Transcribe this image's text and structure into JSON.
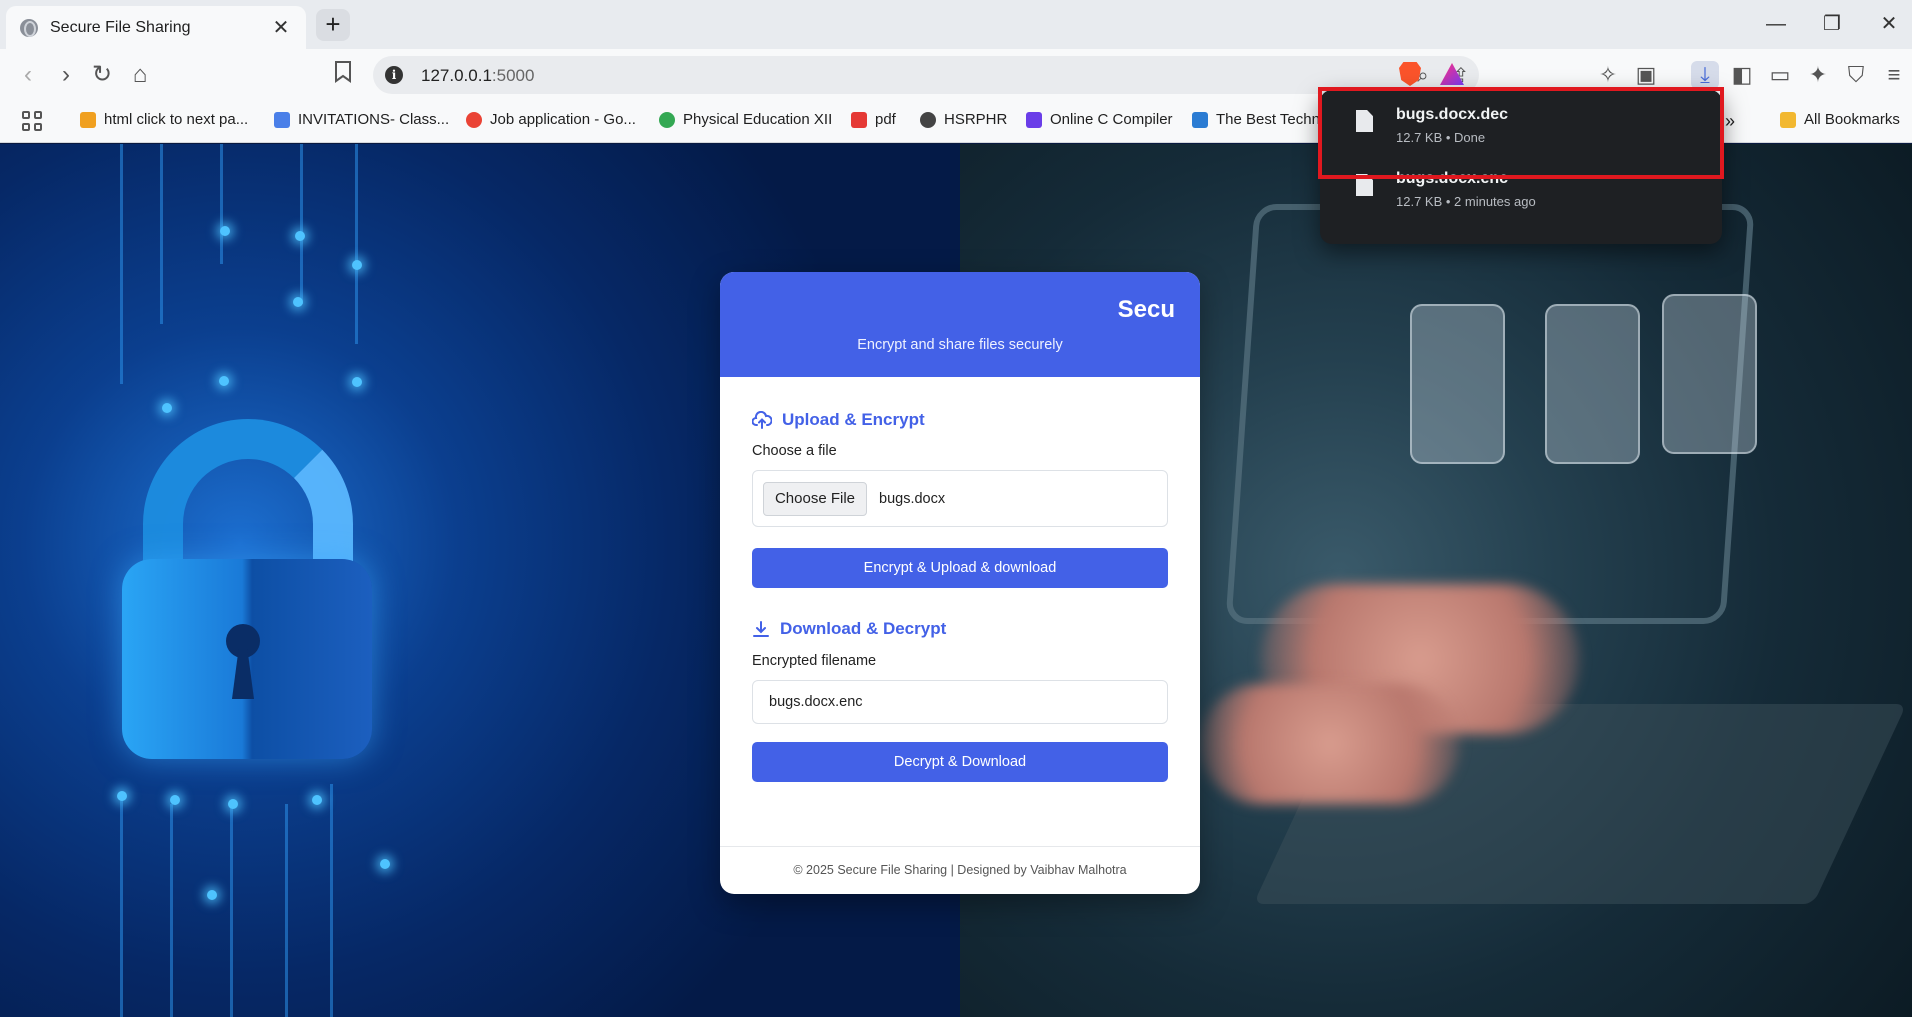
{
  "browser": {
    "tab_title": "Secure File Sharing",
    "tab_close": "✕",
    "new_tab": "+",
    "url_host": "127.0.0.1",
    "url_port": ":5000",
    "window": {
      "minimize": "—",
      "restore": "❐",
      "close": "✕"
    }
  },
  "bookmarks": [
    {
      "label": "html click to next pa...",
      "color": "#f0a020"
    },
    {
      "label": "INVITATIONS- Class...",
      "color": "#4a7fe8"
    },
    {
      "label": "Job application - Go...",
      "color": "#ea4335"
    },
    {
      "label": "Physical Education XII",
      "color": "#34a853"
    },
    {
      "label": "pdf",
      "color": "#e53935"
    },
    {
      "label": "HSRPHR",
      "color": "#444444"
    },
    {
      "label": "Online C Compiler",
      "color": "#6a3de8"
    },
    {
      "label": "The Best Techn",
      "color": "#2b7cd3"
    }
  ],
  "bookmarks_more": "»",
  "all_bookmarks": "All Bookmarks",
  "downloads": [
    {
      "name": "bugs.docx.dec",
      "meta": "12.7 KB • Done"
    },
    {
      "name": "bugs.docx.enc",
      "meta": "12.7 KB • 2 minutes ago"
    }
  ],
  "card": {
    "title": "Secu",
    "subtitle": "Encrypt and share files securely",
    "upload": {
      "heading": "Upload & Encrypt",
      "label": "Choose a file",
      "choose_button": "Choose File",
      "file_name": "bugs.docx",
      "submit": "Encrypt & Upload & download"
    },
    "download": {
      "heading": "Download & Decrypt",
      "label": "Encrypted filename",
      "value": "bugs.docx.enc",
      "submit": "Decrypt & Download"
    },
    "footer": "© 2025 Secure File Sharing | Designed by Vaibhav Malhotra"
  },
  "colors": {
    "accent": "#4361e7",
    "highlight": "#e0181f",
    "popup": "#1e2023"
  }
}
